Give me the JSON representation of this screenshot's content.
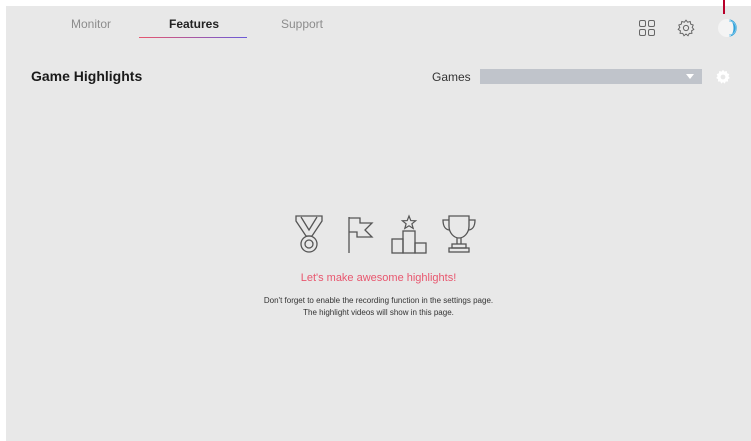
{
  "nav": {
    "tabs": [
      {
        "label": "Monitor",
        "active": false
      },
      {
        "label": "Features",
        "active": true
      },
      {
        "label": "Support",
        "active": false
      }
    ],
    "icons": [
      "grid-icon",
      "settings-gear-icon",
      "profile-avatar-icon"
    ]
  },
  "header": {
    "title": "Game Highlights",
    "games_label": "Games",
    "games_selected": ""
  },
  "empty_state": {
    "icons": [
      "medal-icon",
      "flag-icon",
      "podium-icon",
      "trophy-icon"
    ],
    "cta": "Let's make awesome highlights!",
    "hint_line1": "Don't forget to enable the recording function in the settings page.",
    "hint_line2": "The highlight videos will show in this page."
  },
  "colors": {
    "background": "#e8e8e8",
    "accent_pink": "#e8566e",
    "accent_purple": "#6a5ad8",
    "select_bg": "#c0c4cb",
    "indicator": "#b8002a"
  }
}
